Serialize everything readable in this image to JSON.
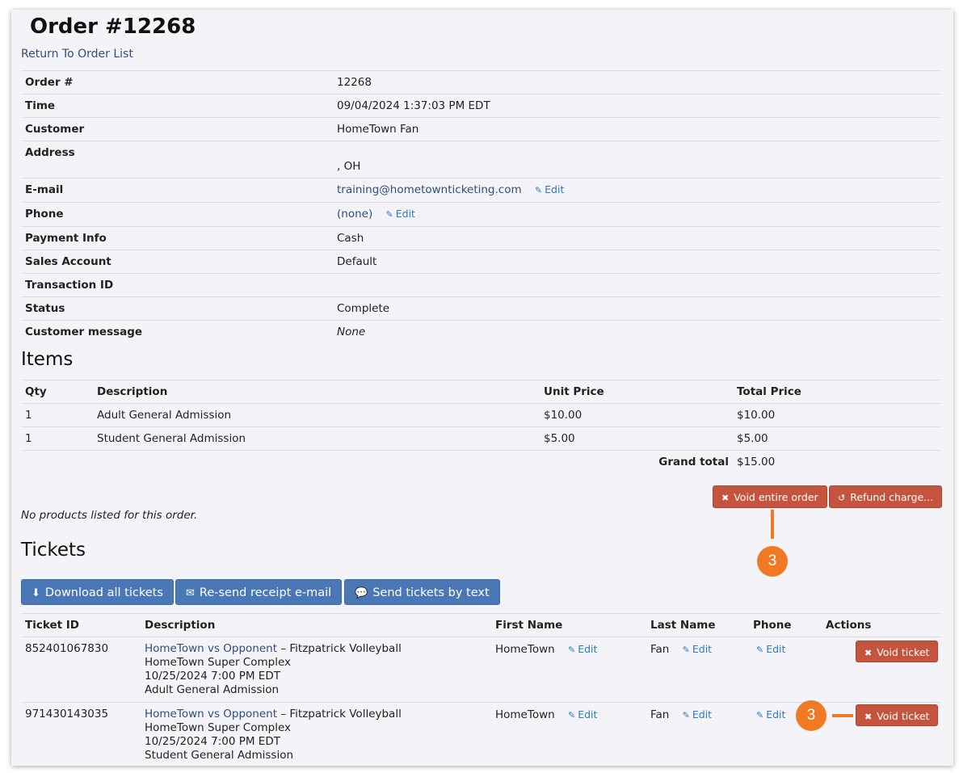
{
  "header": {
    "title": "Order #12268",
    "back_link": "Return To Order List"
  },
  "order_info": [
    {
      "label": "Order #",
      "value": "12268"
    },
    {
      "label": "Time",
      "value": "09/04/2024 1:37:03 PM EDT"
    },
    {
      "label": "Customer",
      "value": "HomeTown Fan"
    },
    {
      "label": "Address",
      "value": ", OH"
    },
    {
      "label": "E-mail",
      "value": "training@hometownticketing.com",
      "edit": "Edit"
    },
    {
      "label": "Phone",
      "value": "(none)",
      "edit": "Edit"
    },
    {
      "label": "Payment Info",
      "value": "Cash"
    },
    {
      "label": "Sales Account",
      "value": "Default"
    },
    {
      "label": "Transaction ID",
      "value": ""
    },
    {
      "label": "Status",
      "value": "Complete"
    },
    {
      "label": "Customer message",
      "value": "None"
    }
  ],
  "items": {
    "title": "Items",
    "columns": [
      "Qty",
      "Description",
      "Unit Price",
      "Total Price"
    ],
    "rows": [
      {
        "qty": "1",
        "description": "Adult General Admission",
        "unit_price": "$10.00",
        "total_price": "$10.00"
      },
      {
        "qty": "1",
        "description": "Student General Admission",
        "unit_price": "$5.00",
        "total_price": "$5.00"
      }
    ],
    "grand_total_label": "Grand total",
    "grand_total": "$15.00"
  },
  "order_actions": {
    "void_order": "Void entire order",
    "refund": "Refund charge..."
  },
  "no_products": "No products listed for this order.",
  "tickets": {
    "title": "Tickets",
    "buttons": {
      "download": "Download all tickets",
      "resend": "Re-send receipt e-mail",
      "text": "Send tickets by text"
    },
    "columns": [
      "Ticket ID",
      "Description",
      "First Name",
      "Last Name",
      "Phone",
      "Actions"
    ],
    "rows": [
      {
        "id": "852401067830",
        "event_link": "HomeTown vs Opponent",
        "event_suffix": " – Fitzpatrick Volleyball",
        "venue": "HomeTown Super Complex",
        "datetime": "10/25/2024 7:00 PM EDT",
        "admission": "Adult General Admission",
        "first_name": "HomeTown",
        "last_name": "Fan",
        "edit": "Edit",
        "void": "Void ticket"
      },
      {
        "id": "971430143035",
        "event_link": "HomeTown vs Opponent",
        "event_suffix": " – Fitzpatrick Volleyball",
        "venue": "HomeTown Super Complex",
        "datetime": "10/25/2024 7:00 PM EDT",
        "admission": "Student General Admission",
        "first_name": "HomeTown",
        "last_name": "Fan",
        "edit": "Edit",
        "void": "Void ticket"
      }
    ]
  },
  "callouts": [
    "3",
    "3"
  ],
  "colors": {
    "accent_blue": "#4a77b5",
    "danger_red": "#c4543e",
    "callout_orange": "#f07a24",
    "link": "#2c4f7c"
  },
  "icons": {
    "edit": "pencil-icon",
    "void": "x-icon",
    "refund": "undo-icon",
    "download": "download-icon",
    "resend": "envelope-icon",
    "text": "chat-bubble-icon"
  }
}
